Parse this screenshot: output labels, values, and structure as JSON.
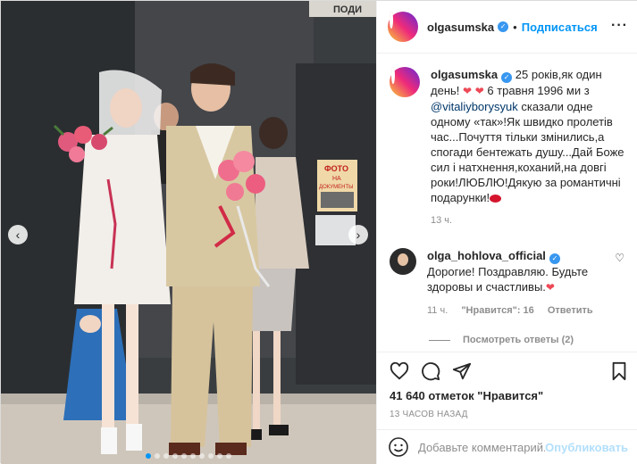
{
  "colors": {
    "accent": "#0095f6",
    "verified": "#3897f0",
    "heart": "#ed4956",
    "muted": "#8e8e8e"
  },
  "header": {
    "username": "olgasumska",
    "separator": "•",
    "follow_label": "Подписаться",
    "more_icon": "more-horizontal-icon"
  },
  "media": {
    "sign_top": "ПОДИ",
    "sign_foto_1": "ФОТО",
    "sign_foto_2": "НА",
    "sign_foto_3": "ДОКУМЕНТЫ",
    "slides": 10,
    "active_slide": 1
  },
  "caption": {
    "username": "olgasumska",
    "text_1": " 25 років,як один день! ",
    "text_2": " 6 травня 1996 ми з ",
    "mention": "@vitaliyborysyuk",
    "text_3": " сказали одне одному «так»!Як швидко пролетів час...Почуття тільки змінились,а спогади бентежать душу...Дай Боже сил і натхнення,коханий,на довгі роки!ЛЮБЛЮ!Дякую за романтичні подарунки!",
    "time": "13 ч."
  },
  "comment": {
    "username": "olga_hohlova_official",
    "text": " Дорогие! Поздравляю. Будьте здоровы и счастливы.",
    "time": "11 ч.",
    "likes": "\"Нравится\": 16",
    "reply_label": "Ответить"
  },
  "view_replies": "Посмотреть ответы (2)",
  "likes_count": "41 640 отметок \"Нравится\"",
  "post_time": "13 ЧАСОВ НАЗАД",
  "add_comment": {
    "placeholder": "Добавьте комментарий...",
    "publish_label": "Опубликовать"
  }
}
